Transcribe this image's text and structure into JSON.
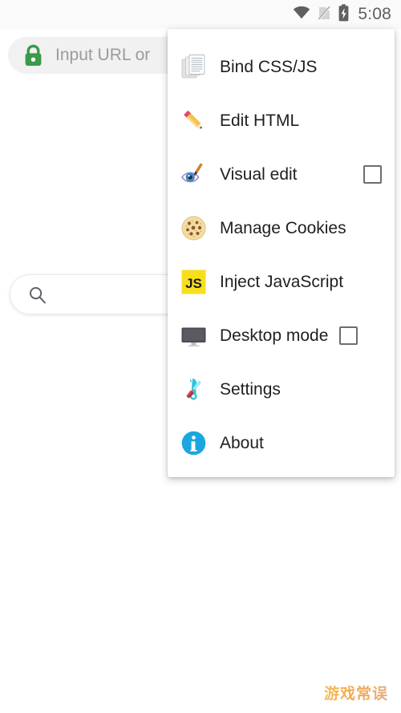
{
  "status_bar": {
    "time": "5:08",
    "icons": [
      "wifi-icon",
      "sim-card-off-icon",
      "battery-charging-icon"
    ]
  },
  "browser": {
    "url_bar": {
      "lock_icon": "lock-secure-icon",
      "placeholder": "Input URL or ",
      "value": ""
    }
  },
  "page": {
    "search": {
      "icon": "search-icon",
      "value": "",
      "placeholder": ""
    },
    "watermark": "游戏常误"
  },
  "menu": {
    "items": [
      {
        "label": "Bind CSS/JS",
        "icon": "documents-stack-icon",
        "has_checkbox": false,
        "checked": false
      },
      {
        "label": "Edit HTML",
        "icon": "pencil-icon",
        "has_checkbox": false,
        "checked": false
      },
      {
        "label": "Visual edit",
        "icon": "eye-brush-icon",
        "has_checkbox": true,
        "checked": false
      },
      {
        "label": "Manage Cookies",
        "icon": "cookie-icon",
        "has_checkbox": false,
        "checked": false
      },
      {
        "label": "Inject JavaScript",
        "icon": "js-logo-icon",
        "has_checkbox": false,
        "checked": false
      },
      {
        "label": "Desktop mode",
        "icon": "monitor-icon",
        "has_checkbox": true,
        "checked": false
      },
      {
        "label": "Settings",
        "icon": "tools-icon",
        "has_checkbox": false,
        "checked": false
      },
      {
        "label": "About",
        "icon": "info-circle-icon",
        "has_checkbox": false,
        "checked": false
      }
    ]
  },
  "colors": {
    "lock_green": "#3a9a48",
    "js_yellow": "#f7df1e",
    "info_blue": "#1ba6e0",
    "status_grey": "#5f5f5f",
    "url_bar_bg": "#f1f1f1",
    "watermark_orange": "#f0a040"
  }
}
